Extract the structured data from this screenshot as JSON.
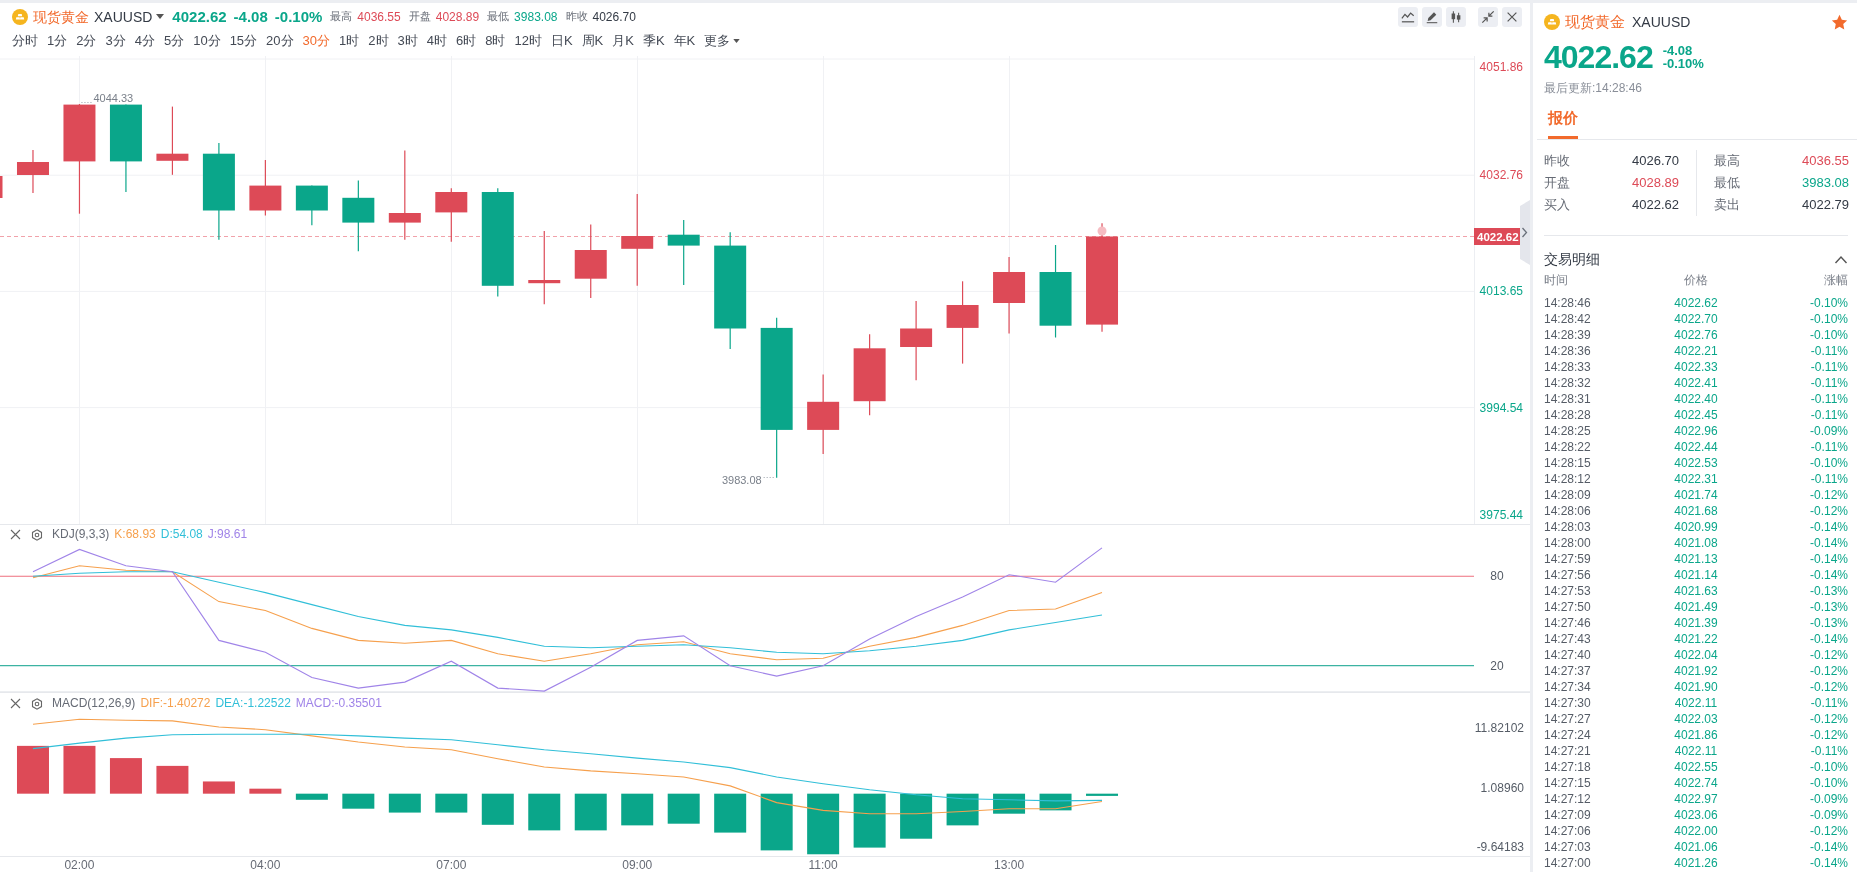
{
  "header": {
    "name": "现货黄金",
    "symbol": "XAUUSD",
    "price": "4022.62",
    "change": "-4.08",
    "change_pct": "-0.10%",
    "stats": [
      {
        "label": "最高",
        "value": "4036.55",
        "color": "#dd4a57"
      },
      {
        "label": "开盘",
        "value": "4028.89",
        "color": "#dd4a57"
      },
      {
        "label": "最低",
        "value": "3983.08",
        "color": "#0aa68a"
      },
      {
        "label": "昨收",
        "value": "4026.70",
        "color": "#333a45"
      }
    ]
  },
  "periods": [
    {
      "label": "分时",
      "selected": false,
      "kind": "period"
    },
    {
      "label": "1分",
      "selected": false,
      "kind": "period"
    },
    {
      "label": "2分",
      "selected": false,
      "kind": "period"
    },
    {
      "label": "3分",
      "selected": false,
      "kind": "period"
    },
    {
      "label": "4分",
      "selected": false,
      "kind": "period"
    },
    {
      "label": "5分",
      "selected": false,
      "kind": "period"
    },
    {
      "label": "10分",
      "selected": false,
      "kind": "period"
    },
    {
      "label": "15分",
      "selected": false,
      "kind": "period"
    },
    {
      "label": "20分",
      "selected": false,
      "kind": "period"
    },
    {
      "label": "30分",
      "selected": true,
      "kind": "period"
    },
    {
      "label": "1时",
      "selected": false,
      "kind": "period"
    },
    {
      "label": "2时",
      "selected": false,
      "kind": "period"
    },
    {
      "label": "3时",
      "selected": false,
      "kind": "period"
    },
    {
      "label": "4时",
      "selected": false,
      "kind": "period"
    },
    {
      "label": "6时",
      "selected": false,
      "kind": "period"
    },
    {
      "label": "8时",
      "selected": false,
      "kind": "period"
    },
    {
      "label": "12时",
      "selected": false,
      "kind": "period"
    },
    {
      "label": "日K",
      "selected": false,
      "kind": "period"
    },
    {
      "label": "周K",
      "selected": false,
      "kind": "period"
    },
    {
      "label": "月K",
      "selected": false,
      "kind": "period"
    },
    {
      "label": "季K",
      "selected": false,
      "kind": "period"
    },
    {
      "label": "年K",
      "selected": false,
      "kind": "period"
    },
    {
      "label": "更多",
      "selected": false,
      "kind": "dropdown"
    }
  ],
  "price_axis": {
    "ticks": [
      {
        "label": "4051.86",
        "color": "#dd4a57"
      },
      {
        "label": "4032.76",
        "color": "#dd4a57"
      },
      {
        "label": "4013.65",
        "color": "#0aa68a"
      },
      {
        "label": "3994.54",
        "color": "#0aa68a"
      },
      {
        "label": "3975.44",
        "color": "#0aa68a"
      }
    ],
    "last_price": "4022.62"
  },
  "chart_labels": {
    "high": "4044.33",
    "low": "3983.08"
  },
  "kdj": {
    "title": "KDJ(9,3,3)",
    "readouts": [
      {
        "text": "K:68.93",
        "color": "#f6a04d"
      },
      {
        "text": "D:54.08",
        "color": "#31bfd8"
      },
      {
        "text": "J:98.61",
        "color": "#a084e8"
      }
    ],
    "chart_data": {
      "type": "line",
      "ylim": [
        2.7,
        114.7
      ],
      "yticks": [
        80,
        20
      ],
      "ref_lines": [
        {
          "axis": "y",
          "value": 80,
          "color": "#ee6f7e"
        },
        {
          "axis": "y",
          "value": 20,
          "color": "#3cb3a2"
        }
      ],
      "series": [
        {
          "color": "#f6a04d",
          "values": [
            79,
            87,
            84,
            83,
            63,
            57,
            45,
            37,
            35,
            37,
            28,
            23,
            28,
            34,
            36,
            28,
            24,
            25,
            33,
            39,
            47,
            57,
            58,
            69
          ]
        },
        {
          "color": "#31bfd8",
          "values": [
            80,
            82,
            83,
            83,
            76,
            69,
            61,
            53,
            47,
            44,
            39,
            33,
            32,
            33,
            34,
            32,
            29,
            28,
            30,
            33,
            37,
            44,
            49,
            54
          ]
        },
        {
          "color": "#a084e8",
          "values": [
            83,
            98,
            87,
            83,
            37,
            29,
            12,
            5,
            9,
            23,
            5,
            3,
            19,
            37,
            40,
            20,
            13,
            20,
            38,
            53,
            66,
            81,
            76,
            99
          ]
        }
      ]
    }
  },
  "macd": {
    "title": "MACD(12,26,9)",
    "readouts": [
      {
        "text": "DIF:-1.40272",
        "color": "#f6a04d"
      },
      {
        "text": "DEA:-1.22522",
        "color": "#31bfd8"
      },
      {
        "text": "MACD:-0.35501",
        "color": "#a084e8"
      }
    ],
    "chart_data": {
      "type": "bar",
      "ylim": [
        -11.3,
        18.2
      ],
      "yticks": [
        {
          "value": 11.82102,
          "label": "11.82102"
        },
        {
          "value": 1.0896,
          "label": "1.08960"
        },
        {
          "value": -9.64183,
          "label": "-9.64183"
        }
      ],
      "series": [
        {
          "type": "line",
          "color": "#f6a04d",
          "values": [
            12.5,
            13.4,
            13.2,
            13.1,
            12.0,
            11.5,
            10.4,
            9.3,
            8.4,
            7.9,
            6.3,
            4.8,
            4.1,
            3.6,
            3.0,
            1.4,
            -1.6,
            -3.0,
            -3.6,
            -3.6,
            -3.2,
            -2.7,
            -2.7,
            -1.4
          ]
        },
        {
          "type": "line",
          "color": "#31bfd8",
          "values": [
            8.1,
            9.1,
            10.0,
            10.6,
            10.7,
            10.7,
            10.7,
            10.4,
            10.0,
            9.7,
            8.8,
            7.9,
            7.2,
            6.4,
            5.7,
            4.7,
            3.0,
            1.8,
            0.7,
            -0.2,
            -0.9,
            -1.1,
            -1.3,
            -1.2
          ]
        },
        {
          "type": "bar",
          "values": [
            8.6,
            8.6,
            6.4,
            5.0,
            2.2,
            0.9,
            -1.1,
            -2.7,
            -3.4,
            -3.4,
            -5.6,
            -6.6,
            -6.6,
            -5.7,
            -5.4,
            -7.0,
            -10.2,
            -10.9,
            -9.7,
            -8.1,
            -5.7,
            -3.6,
            -3.0,
            -0.4
          ],
          "colors": [
            "#dd4a57",
            "#dd4a57",
            "#dd4a57",
            "#dd4a57",
            "#dd4a57",
            "#dd4a57",
            "#0aa68a",
            "#0aa68a",
            "#0aa68a",
            "#0aa68a",
            "#0aa68a",
            "#0aa68a",
            "#0aa68a",
            "#0aa68a",
            "#0aa68a",
            "#0aa68a",
            "#0aa68a",
            "#0aa68a",
            "#0aa68a",
            "#0aa68a",
            "#0aa68a",
            "#0aa68a",
            "#0aa68a",
            "#0aa68a"
          ]
        }
      ]
    },
    "time_axis": [
      "02:00",
      "04:00",
      "07:00",
      "09:00",
      "11:00",
      "13:00"
    ]
  },
  "quote_panel": {
    "name": "现货黄金",
    "symbol": "XAUUSD",
    "starred": true,
    "price": "4022.62",
    "change": "-4.08",
    "change_pct": "-0.10%",
    "updated": "最后更新:14:28:46",
    "tabs": [
      {
        "label": "报价",
        "selected": true
      }
    ],
    "quotes": [
      {
        "label": "昨收",
        "value": "4026.70",
        "color": "#333a45"
      },
      {
        "label": "最高",
        "value": "4036.55",
        "color": "#dd4a57"
      },
      {
        "label": "开盘",
        "value": "4028.89",
        "color": "#dd4a57"
      },
      {
        "label": "最低",
        "value": "3983.08",
        "color": "#0aa68a"
      },
      {
        "label": "买入",
        "value": "4022.62",
        "color": "#333a45"
      },
      {
        "label": "卖出",
        "value": "4022.79",
        "color": "#333a45"
      }
    ],
    "trades": {
      "title": "交易明细",
      "expanded": true,
      "columns": [
        "时间",
        "价格",
        "涨幅"
      ],
      "rows": [
        [
          "14:28:46",
          "4022.62",
          "-0.10%"
        ],
        [
          "14:28:42",
          "4022.70",
          "-0.10%"
        ],
        [
          "14:28:39",
          "4022.76",
          "-0.10%"
        ],
        [
          "14:28:36",
          "4022.21",
          "-0.11%"
        ],
        [
          "14:28:33",
          "4022.33",
          "-0.11%"
        ],
        [
          "14:28:32",
          "4022.41",
          "-0.11%"
        ],
        [
          "14:28:31",
          "4022.40",
          "-0.11%"
        ],
        [
          "14:28:28",
          "4022.45",
          "-0.11%"
        ],
        [
          "14:28:25",
          "4022.96",
          "-0.09%"
        ],
        [
          "14:28:22",
          "4022.44",
          "-0.11%"
        ],
        [
          "14:28:15",
          "4022.53",
          "-0.10%"
        ],
        [
          "14:28:12",
          "4022.31",
          "-0.11%"
        ],
        [
          "14:28:09",
          "4021.74",
          "-0.12%"
        ],
        [
          "14:28:06",
          "4021.68",
          "-0.12%"
        ],
        [
          "14:28:03",
          "4020.99",
          "-0.14%"
        ],
        [
          "14:28:00",
          "4021.08",
          "-0.14%"
        ],
        [
          "14:27:59",
          "4021.13",
          "-0.14%"
        ],
        [
          "14:27:56",
          "4021.14",
          "-0.14%"
        ],
        [
          "14:27:53",
          "4021.63",
          "-0.13%"
        ],
        [
          "14:27:50",
          "4021.49",
          "-0.13%"
        ],
        [
          "14:27:46",
          "4021.39",
          "-0.13%"
        ],
        [
          "14:27:43",
          "4021.22",
          "-0.14%"
        ],
        [
          "14:27:40",
          "4022.04",
          "-0.12%"
        ],
        [
          "14:27:37",
          "4021.92",
          "-0.12%"
        ],
        [
          "14:27:34",
          "4021.90",
          "-0.12%"
        ],
        [
          "14:27:30",
          "4022.11",
          "-0.11%"
        ],
        [
          "14:27:27",
          "4022.03",
          "-0.12%"
        ],
        [
          "14:27:24",
          "4021.86",
          "-0.12%"
        ],
        [
          "14:27:21",
          "4022.11",
          "-0.11%"
        ],
        [
          "14:27:18",
          "4022.55",
          "-0.10%"
        ],
        [
          "14:27:15",
          "4022.74",
          "-0.10%"
        ],
        [
          "14:27:12",
          "4022.97",
          "-0.09%"
        ],
        [
          "14:27:09",
          "4023.06",
          "-0.09%"
        ],
        [
          "14:27:06",
          "4022.00",
          "-0.12%"
        ],
        [
          "14:27:03",
          "4021.06",
          "-0.14%"
        ],
        [
          "14:27:00",
          "4021.26",
          "-0.14%"
        ]
      ]
    }
  }
}
